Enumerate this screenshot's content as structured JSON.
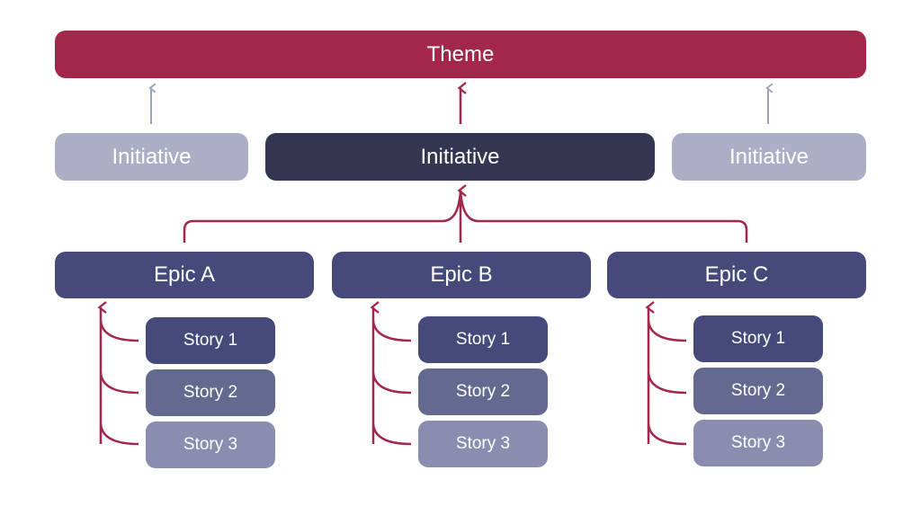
{
  "theme": {
    "label": "Theme",
    "color": "#a3274a"
  },
  "initiatives": [
    {
      "label": "Initiative",
      "state": "inactive",
      "color": "#abaec5"
    },
    {
      "label": "Initiative",
      "state": "active",
      "color": "#353652"
    },
    {
      "label": "Initiative",
      "state": "inactive",
      "color": "#abaec5"
    }
  ],
  "epics": [
    {
      "label": "Epic A",
      "stories": [
        "Story 1",
        "Story 2",
        "Story 3"
      ]
    },
    {
      "label": "Epic B",
      "stories": [
        "Story 1",
        "Story 2",
        "Story 3"
      ]
    },
    {
      "label": "Epic C",
      "stories": [
        "Story 1",
        "Story 2",
        "Story 3"
      ]
    }
  ],
  "colors": {
    "connector_active": "#a3274a",
    "connector_inactive": "#9ea3bd",
    "epic": "#454a7a",
    "story_1": "#454a7a",
    "story_2": "#64698f",
    "story_3": "#8a8daf"
  }
}
